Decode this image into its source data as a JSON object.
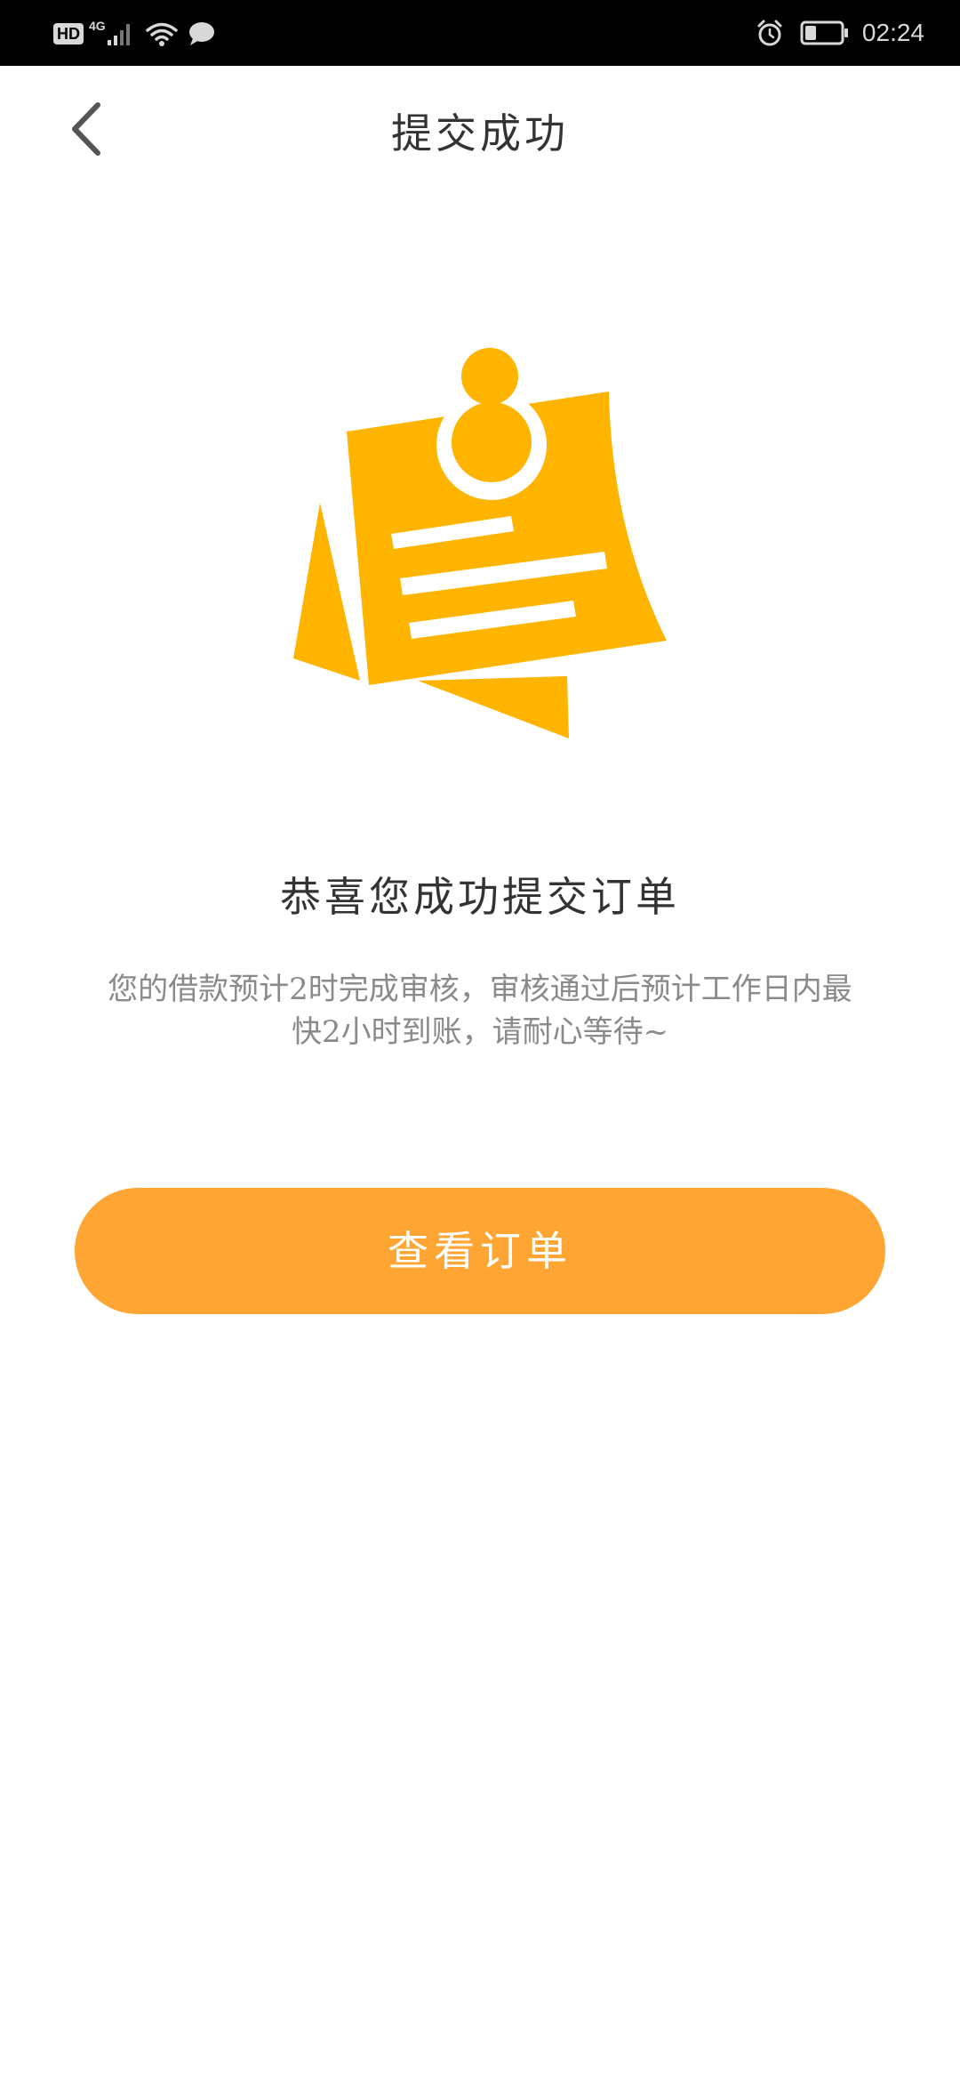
{
  "status_bar": {
    "hd": "HD",
    "network": "4G",
    "time": "02:24"
  },
  "nav": {
    "title": "提交成功"
  },
  "main": {
    "headline": "恭喜您成功提交订单",
    "description": "您的借款预计2时完成审核，审核通过后预计工作日内最快2小时到账，请耐心等待~",
    "button_label": "查看订单"
  },
  "colors": {
    "accent": "#ffa533",
    "illustration": "#ffb400"
  }
}
